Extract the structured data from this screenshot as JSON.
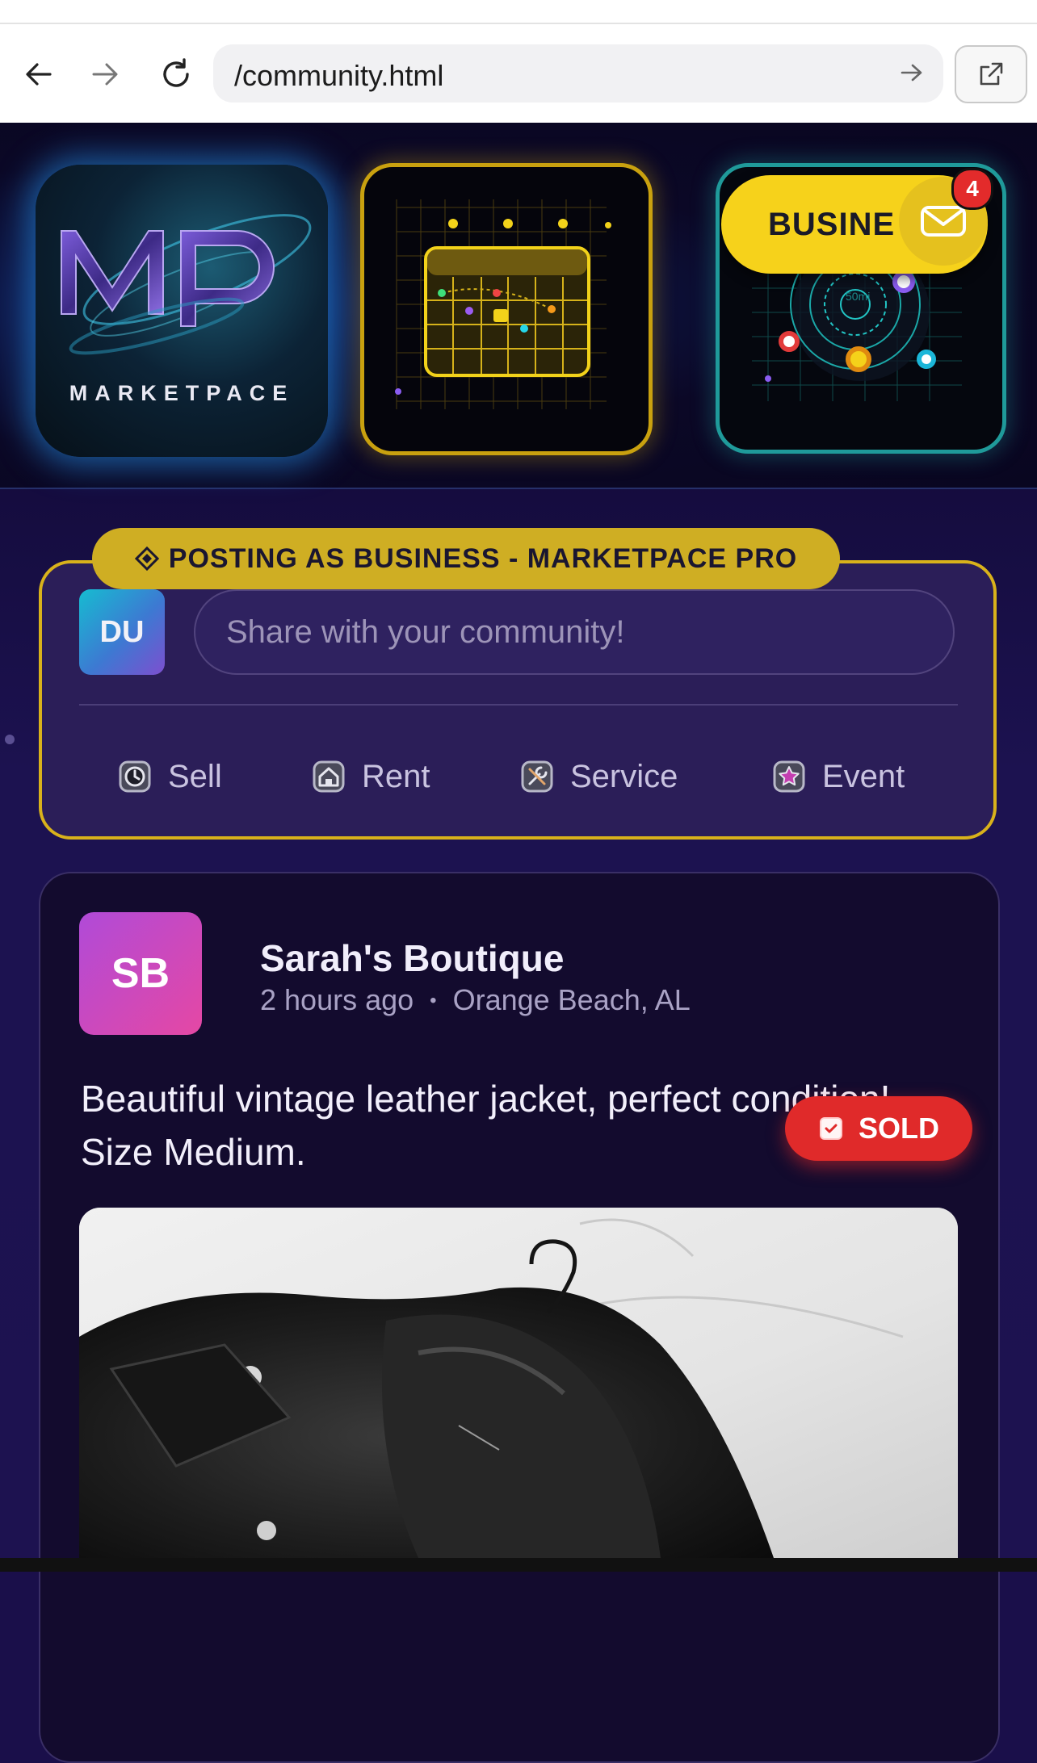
{
  "browser": {
    "url": "/community.html"
  },
  "hero": {
    "logo_text": "MARKETPACE",
    "business_label": "BUSINE",
    "notification_count": "4",
    "map_label": "50mi"
  },
  "composer": {
    "posting_as": "POSTING AS BUSINESS - MARKETPACE PRO",
    "avatar_initials": "DU",
    "placeholder": "Share with your community!",
    "actions": [
      {
        "label": "Sell",
        "icon": "clock-icon"
      },
      {
        "label": "Rent",
        "icon": "home-icon"
      },
      {
        "label": "Service",
        "icon": "tools-icon"
      },
      {
        "label": "Event",
        "icon": "star-icon"
      }
    ]
  },
  "post": {
    "avatar_initials": "SB",
    "author": "Sarah's Boutique",
    "time": "2 hours ago",
    "separator": "•",
    "location": "Orange Beach, AL",
    "text": "Beautiful vintage leather jacket, perfect condition! Size Medium.",
    "status_badge": "SOLD"
  },
  "colors": {
    "accent_gold": "#d9b21b",
    "sold_red": "#e02a2a",
    "background": "#1a0f4a"
  }
}
